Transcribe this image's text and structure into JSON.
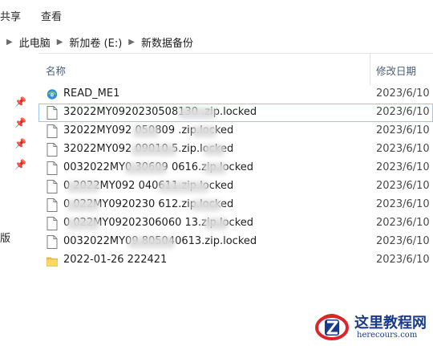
{
  "ribbon": {
    "tabs": [
      "共享",
      "查看"
    ]
  },
  "addressbar": {
    "crumbs": [
      "此电脑",
      "新加卷 (E:)",
      "新数据备份"
    ]
  },
  "sidebar": {
    "label": "版"
  },
  "header": {
    "name": "名称",
    "date": "修改日期"
  },
  "files": [
    {
      "name": "READ_ME1",
      "date": "2023/6/10",
      "type": "html"
    },
    {
      "name": "32022MY0920230508130      .zip.locked",
      "date": "2023/6/10",
      "type": "file"
    },
    {
      "name": "32022MY092      050809     .zip.locked",
      "date": "2023/6/10",
      "type": "file"
    },
    {
      "name": "32022MY092          09010      5.zip.locked",
      "date": "2023/6/10",
      "type": "file"
    },
    {
      "name": "0032022MY0         30609      0616.zip.locked",
      "date": "2023/6/10",
      "type": "file"
    },
    {
      "name": "0      2022MY092           040611.zip.locked",
      "date": "2023/6/10",
      "type": "file"
    },
    {
      "name": "0      022MY0920230        612.zip.locked",
      "date": "2023/6/10",
      "type": "file"
    },
    {
      "name": "0      022MY09202306060      13.zip.locked",
      "date": "2023/6/10",
      "type": "file"
    },
    {
      "name": "0032022MY09          805040613.zip.locked",
      "date": "2023/6/10",
      "type": "file"
    },
    {
      "name": "2022-01-26 222421",
      "date": "2023/6/10",
      "type": "folder"
    }
  ],
  "watermark": {
    "title": "这里教程网",
    "url": "herecours.com"
  }
}
